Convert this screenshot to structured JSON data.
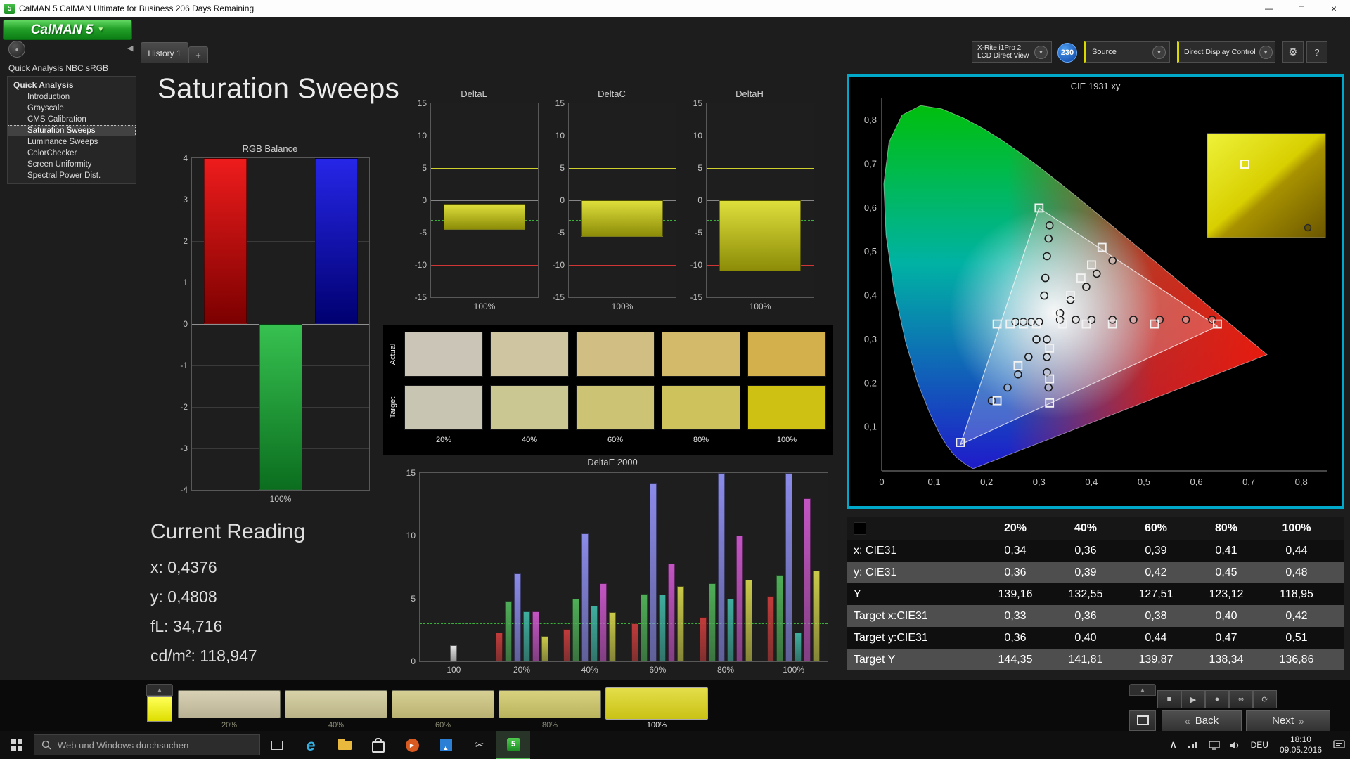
{
  "titlebar": {
    "title": "CalMAN 5 CalMAN Ultimate for Business 206 Days Remaining",
    "icon": "5",
    "minimize": "—",
    "maximize": "□",
    "close": "×"
  },
  "logo": {
    "text": "CalMAN 5",
    "caret": "▼"
  },
  "sidebar": {
    "title": "Quick Analysis NBC sRGB",
    "root": "Quick Analysis",
    "items": [
      {
        "label": "Introduction",
        "selected": false
      },
      {
        "label": "Grayscale",
        "selected": false
      },
      {
        "label": "CMS Calibration",
        "selected": false
      },
      {
        "label": "Saturation Sweeps",
        "selected": true
      },
      {
        "label": "Luminance Sweeps",
        "selected": false
      },
      {
        "label": "ColorChecker",
        "selected": false
      },
      {
        "label": "Screen Uniformity",
        "selected": false
      },
      {
        "label": "Spectral Power Dist.",
        "selected": false
      }
    ]
  },
  "tabs": {
    "history": "History 1",
    "add": "+"
  },
  "toolbar": {
    "meter_line1": "X-Rite i1Pro 2",
    "meter_line2": "LCD Direct View",
    "badge": "230",
    "source": "Source",
    "display_control": "Direct Display Control",
    "gear": "⚙",
    "help": "?",
    "dropdown_glyph": "▼"
  },
  "page": {
    "heading": "Saturation Sweeps"
  },
  "current_reading": {
    "heading": "Current Reading",
    "lines": [
      "x: 0,4376",
      "y: 0,4808",
      "fL: 34,716",
      "cd/m²: 118,947"
    ]
  },
  "swatch_panel": {
    "row_labels": [
      "Actual",
      "Target"
    ],
    "col_labels": [
      "20%",
      "40%",
      "60%",
      "80%",
      "100%"
    ],
    "actual_colors": [
      "#cbc5b7",
      "#cfc5a1",
      "#d1be83",
      "#d3b96a",
      "#d4b04c"
    ],
    "target_colors": [
      "#c8c6b3",
      "#cbc792",
      "#ccc374",
      "#cdc25c",
      "#cec114"
    ]
  },
  "table": {
    "header": [
      "",
      "20%",
      "40%",
      "60%",
      "80%",
      "100%"
    ],
    "rows": [
      [
        "x: CIE31",
        "0,34",
        "0,36",
        "0,39",
        "0,41",
        "0,44"
      ],
      [
        "y: CIE31",
        "0,36",
        "0,39",
        "0,42",
        "0,45",
        "0,48"
      ],
      [
        "Y",
        "139,16",
        "132,55",
        "127,51",
        "123,12",
        "118,95"
      ],
      [
        "Target x:CIE31",
        "0,33",
        "0,36",
        "0,38",
        "0,40",
        "0,42"
      ],
      [
        "Target y:CIE31",
        "0,36",
        "0,40",
        "0,44",
        "0,47",
        "0,51"
      ],
      [
        "Target Y",
        "144,35",
        "141,81",
        "139,87",
        "138,34",
        "136,86"
      ]
    ]
  },
  "bottom_bar": {
    "swatches": [
      {
        "label": "20%",
        "top": "#d8d1b5",
        "bottom": "#b9b294",
        "selected": false
      },
      {
        "label": "40%",
        "top": "#d8d2a8",
        "bottom": "#bab387",
        "selected": false
      },
      {
        "label": "60%",
        "top": "#d7d094",
        "bottom": "#b9b272",
        "selected": false
      },
      {
        "label": "80%",
        "top": "#d8d17e",
        "bottom": "#bab35e",
        "selected": false
      },
      {
        "label": "100%",
        "top": "#e4de4a",
        "bottom": "#c9c215",
        "selected": true
      }
    ],
    "transport": [
      {
        "name": "stop-button",
        "glyph": "■"
      },
      {
        "name": "play-button",
        "glyph": "▶"
      },
      {
        "name": "record-button",
        "glyph": "●"
      },
      {
        "name": "loop-button",
        "glyph": "∞"
      },
      {
        "name": "refresh-button",
        "glyph": "⟳"
      }
    ],
    "back": "Back",
    "next": "Next",
    "chevron_left": "«",
    "chevron_right": "»"
  },
  "taskbar": {
    "search_placeholder": "Web und Windows durchsuchen",
    "language": "DEU",
    "time": "18:10",
    "date": "09.05.2016"
  },
  "chart_data": [
    {
      "id": "rgb_balance",
      "type": "bar",
      "title": "RGB Balance",
      "categories": [
        "100%"
      ],
      "xlabel": "100%",
      "ylim": [
        -4,
        4
      ],
      "yticks": [
        4,
        3,
        2,
        1,
        0,
        -1,
        -2,
        -3,
        -4
      ],
      "series": [
        {
          "name": "Red",
          "color": "#ee1c1c",
          "color2": "#7c0000",
          "value": 4
        },
        {
          "name": "Green",
          "color": "#37c150",
          "color2": "#0b6e1f",
          "value": -4
        },
        {
          "name": "Blue",
          "color": "#2626e8",
          "color2": "#000070",
          "value": 4
        }
      ]
    },
    {
      "id": "delta_l",
      "type": "range-bar",
      "title": "DeltaL",
      "xlabel": "100%",
      "ylim": [
        -15,
        15
      ],
      "yticks": [
        15,
        10,
        5,
        0,
        -5,
        -10,
        -15
      ],
      "ref": {
        "red": 10,
        "yellow": 5,
        "green": 3
      },
      "bar": {
        "from": -0.5,
        "to": -4.6
      }
    },
    {
      "id": "delta_c",
      "type": "range-bar",
      "title": "DeltaC",
      "xlabel": "100%",
      "ylim": [
        -15,
        15
      ],
      "yticks": [
        15,
        10,
        5,
        0,
        -5,
        -10,
        -15
      ],
      "ref": {
        "red": 10,
        "yellow": 5,
        "green": 3
      },
      "bar": {
        "from": 0,
        "to": -5.6
      }
    },
    {
      "id": "delta_h",
      "type": "range-bar",
      "title": "DeltaH",
      "xlabel": "100%",
      "ylim": [
        -15,
        15
      ],
      "yticks": [
        15,
        10,
        5,
        0,
        -5,
        -10,
        -15
      ],
      "ref": {
        "red": 10,
        "yellow": 5,
        "green": 3
      },
      "bar": {
        "from": 0,
        "to": -11
      }
    },
    {
      "id": "deltae2000",
      "type": "grouped-bar",
      "title": "DeltaE 2000",
      "ylim": [
        0,
        15
      ],
      "yticks": [
        15,
        10,
        5,
        0
      ],
      "ref": {
        "red": 10,
        "yellow": 5,
        "green": 3
      },
      "groups": [
        {
          "label": "100",
          "bars": [
            {
              "color": "#e6e6e6",
              "value": 1.3
            }
          ]
        },
        {
          "label": "20%",
          "bars": [
            {
              "color": "#c23b3b",
              "value": 2.3
            },
            {
              "color": "#4fae57",
              "value": 4.8
            },
            {
              "color": "#8b8bea",
              "value": 7.0
            },
            {
              "color": "#3fae9f",
              "value": 4.0
            },
            {
              "color": "#c455c4",
              "value": 4.0
            },
            {
              "color": "#c9c94a",
              "value": 2.0
            }
          ]
        },
        {
          "label": "40%",
          "bars": [
            {
              "color": "#c23b3b",
              "value": 2.6
            },
            {
              "color": "#4fae57",
              "value": 5.0
            },
            {
              "color": "#8b8bea",
              "value": 10.2
            },
            {
              "color": "#3fae9f",
              "value": 4.4
            },
            {
              "color": "#c455c4",
              "value": 6.2
            },
            {
              "color": "#c9c94a",
              "value": 3.9
            }
          ]
        },
        {
          "label": "60%",
          "bars": [
            {
              "color": "#c23b3b",
              "value": 3.0
            },
            {
              "color": "#4fae57",
              "value": 5.4
            },
            {
              "color": "#8b8bea",
              "value": 14.2
            },
            {
              "color": "#3fae9f",
              "value": 5.3
            },
            {
              "color": "#c455c4",
              "value": 7.8
            },
            {
              "color": "#c9c94a",
              "value": 6.0
            }
          ]
        },
        {
          "label": "80%",
          "bars": [
            {
              "color": "#c23b3b",
              "value": 3.5
            },
            {
              "color": "#4fae57",
              "value": 6.2
            },
            {
              "color": "#8b8bea",
              "value": 15.0
            },
            {
              "color": "#3fae9f",
              "value": 5.0
            },
            {
              "color": "#c455c4",
              "value": 10.0
            },
            {
              "color": "#c9c94a",
              "value": 6.5
            }
          ]
        },
        {
          "label": "100%",
          "bars": [
            {
              "color": "#c23b3b",
              "value": 5.2
            },
            {
              "color": "#4fae57",
              "value": 6.9
            },
            {
              "color": "#8b8bea",
              "value": 15.0
            },
            {
              "color": "#3fae9f",
              "value": 2.3
            },
            {
              "color": "#c455c4",
              "value": 13.0
            },
            {
              "color": "#c9c94a",
              "value": 7.2
            }
          ]
        }
      ]
    },
    {
      "id": "cie1931",
      "type": "scatter",
      "title": "CIE 1931 xy",
      "xlim": [
        0,
        0.85
      ],
      "ylim": [
        0,
        0.85
      ],
      "x_ticks": [
        "0",
        "0,1",
        "0,2",
        "0,3",
        "0,4",
        "0,5",
        "0,6",
        "0,7",
        "0,8"
      ],
      "y_ticks": [
        "0,1",
        "0,2",
        "0,3",
        "0,4",
        "0,5",
        "0,6",
        "0,7",
        "0,8"
      ],
      "gamut_triangle": [
        [
          0.64,
          0.33
        ],
        [
          0.3,
          0.6
        ],
        [
          0.15,
          0.06
        ]
      ],
      "white_point": [
        0.3127,
        0.329
      ],
      "targets": [
        [
          0.33,
          0.36
        ],
        [
          0.36,
          0.4
        ],
        [
          0.38,
          0.44
        ],
        [
          0.4,
          0.47
        ],
        [
          0.42,
          0.51
        ],
        [
          0.345,
          0.335
        ],
        [
          0.39,
          0.335
        ],
        [
          0.44,
          0.335
        ],
        [
          0.52,
          0.335
        ],
        [
          0.64,
          0.335
        ],
        [
          0.3,
          0.6
        ],
        [
          0.295,
          0.335
        ],
        [
          0.27,
          0.335
        ],
        [
          0.245,
          0.335
        ],
        [
          0.22,
          0.335
        ],
        [
          0.26,
          0.24
        ],
        [
          0.22,
          0.16
        ],
        [
          0.15,
          0.065
        ],
        [
          0.32,
          0.28
        ],
        [
          0.32,
          0.21
        ],
        [
          0.32,
          0.155
        ]
      ],
      "measured": [
        [
          0.34,
          0.36
        ],
        [
          0.36,
          0.39
        ],
        [
          0.39,
          0.42
        ],
        [
          0.41,
          0.45
        ],
        [
          0.44,
          0.48
        ],
        [
          0.31,
          0.4
        ],
        [
          0.312,
          0.44
        ],
        [
          0.315,
          0.49
        ],
        [
          0.318,
          0.53
        ],
        [
          0.32,
          0.56
        ],
        [
          0.34,
          0.345
        ],
        [
          0.37,
          0.345
        ],
        [
          0.4,
          0.345
        ],
        [
          0.44,
          0.345
        ],
        [
          0.48,
          0.345
        ],
        [
          0.53,
          0.345
        ],
        [
          0.58,
          0.345
        ],
        [
          0.63,
          0.345
        ],
        [
          0.3,
          0.34
        ],
        [
          0.285,
          0.34
        ],
        [
          0.27,
          0.34
        ],
        [
          0.255,
          0.34
        ],
        [
          0.295,
          0.3
        ],
        [
          0.28,
          0.26
        ],
        [
          0.26,
          0.22
        ],
        [
          0.24,
          0.19
        ],
        [
          0.21,
          0.16
        ],
        [
          0.315,
          0.3
        ],
        [
          0.315,
          0.26
        ],
        [
          0.315,
          0.225
        ],
        [
          0.318,
          0.19
        ]
      ]
    }
  ]
}
